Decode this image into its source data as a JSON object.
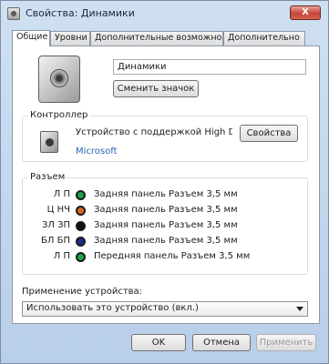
{
  "window": {
    "title": "Свойства: Динамики",
    "close_label": "X"
  },
  "tabs": [
    {
      "label": "Общие",
      "active": true
    },
    {
      "label": "Уровни",
      "active": false
    },
    {
      "label": "Дополнительные возможности",
      "active": false
    },
    {
      "label": "Дополнительно",
      "active": false
    }
  ],
  "general": {
    "device_name": "Динамики",
    "change_icon_label": "Сменить значок"
  },
  "controller": {
    "group_label": "Контроллер",
    "name": "Устройство с поддержкой High Defi...",
    "vendor": "Microsoft",
    "properties_label": "Свойства"
  },
  "jacks": {
    "group_label": "Разъем",
    "items": [
      {
        "channels": "Л П",
        "color": "#1ea34a",
        "description": "Задняя панель Разъем 3,5 мм"
      },
      {
        "channels": "Ц НЧ",
        "color": "#d46a1e",
        "description": "Задняя панель Разъем 3,5 мм"
      },
      {
        "channels": "ЗЛ ЗП",
        "color": "#111111",
        "description": "Задняя панель Разъем 3,5 мм"
      },
      {
        "channels": "БЛ БП",
        "color": "#1c2a8f",
        "description": "Задняя панель Разъем 3,5 мм"
      },
      {
        "channels": "Л П",
        "color": "#1ea34a",
        "description": "Передняя панель Разъем 3,5 мм"
      }
    ]
  },
  "usage": {
    "label": "Применение устройства:",
    "selected": "Использовать это устройство (вкл.)"
  },
  "footer": {
    "ok_label": "OK",
    "cancel_label": "Отмена",
    "apply_label": "Применить"
  }
}
